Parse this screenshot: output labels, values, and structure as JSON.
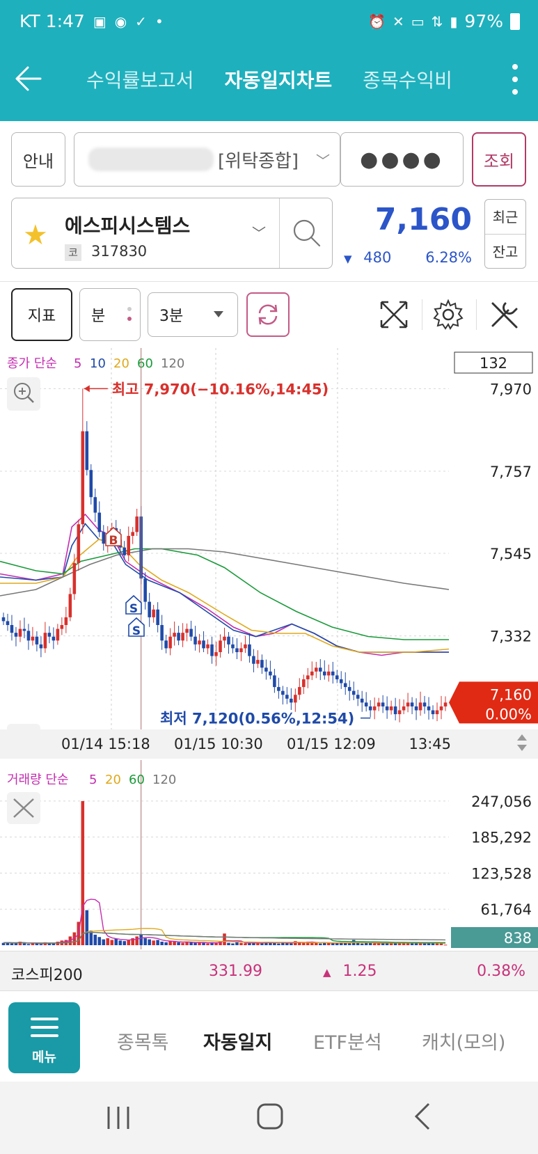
{
  "status_bar": {
    "carrier_time": "KT 1:47",
    "icons_left": [
      "gallery-icon",
      "talk-icon",
      "inv-icon",
      "dot-icon"
    ],
    "battery": "97%",
    "icons_right": [
      "alarm-icon",
      "mute-icon",
      "hd-icon",
      "5g-icon",
      "signal-icon",
      "battery-icon"
    ]
  },
  "header": {
    "tabs": [
      {
        "label": "수익률보고서",
        "active": false
      },
      {
        "label": "자동일지차트",
        "active": true
      },
      {
        "label": "종목수익비",
        "active": false
      }
    ]
  },
  "account_row": {
    "guide_label": "안내",
    "account_text": "[위탁종합]",
    "password_mask": "●●●●",
    "lookup_label": "조회"
  },
  "stock": {
    "name": "에스피시스템스",
    "market_badge": "코",
    "code": "317830",
    "price": "7,160",
    "change": "480",
    "change_pct": "6.28%",
    "recent_label": "최근",
    "balance_label": "잔고",
    "colors": {
      "down": "#2b55c8",
      "up": "#d8302c"
    }
  },
  "toolbar": {
    "indicator_label": "지표",
    "minute_label": "분",
    "interval_value": "3분"
  },
  "chart_data": [
    {
      "type": "candlestick",
      "legend": {
        "prefix": "종가 단순",
        "periods": [
          {
            "label": "5",
            "color": "#c42cb0"
          },
          {
            "label": "10",
            "color": "#1f4aa8"
          },
          {
            "label": "20",
            "color": "#e0a81a"
          },
          {
            "label": "60",
            "color": "#1a9a3a"
          },
          {
            "label": "120",
            "color": "#777777"
          }
        ]
      },
      "counter_label": "132",
      "y_ticks": [
        "7,970",
        "7,757",
        "7,545",
        "7,332"
      ],
      "ylim": [
        7105,
        7985
      ],
      "x_labels": [
        "01/14 15:18",
        "01/15 10:30",
        "01/15 12:09",
        "13:45"
      ],
      "high_annotation": "최고 7,970(−10.16%,14:45)",
      "low_annotation": "최저 7,120(0.56%,12:54)",
      "last_price_tag": {
        "price": "7,160",
        "pct": "0.00%"
      },
      "markers": [
        "B",
        "S",
        "S"
      ],
      "close": [
        7370,
        7360,
        7340,
        7330,
        7350,
        7345,
        7320,
        7330,
        7310,
        7300,
        7340,
        7330,
        7320,
        7350,
        7360,
        7380,
        7440,
        7520,
        7620,
        7860,
        7760,
        7690,
        7650,
        7600,
        7570,
        7590,
        7610,
        7580,
        7560,
        7540,
        7590,
        7600,
        7640,
        7480,
        7420,
        7380,
        7400,
        7360,
        7320,
        7300,
        7330,
        7340,
        7320,
        7340,
        7350,
        7330,
        7310,
        7320,
        7300,
        7310,
        7280,
        7290,
        7320,
        7330,
        7310,
        7300,
        7290,
        7300,
        7310,
        7280,
        7260,
        7270,
        7250,
        7240,
        7230,
        7200,
        7190,
        7180,
        7170,
        7160,
        7180,
        7200,
        7220,
        7230,
        7240,
        7250,
        7240,
        7230,
        7240,
        7230,
        7220,
        7210,
        7200,
        7190,
        7180,
        7170,
        7160,
        7150,
        7140,
        7150,
        7160,
        7150,
        7140,
        7150,
        7130,
        7140,
        7150,
        7160,
        7150,
        7140,
        7160,
        7150,
        7140,
        7130,
        7140,
        7150,
        7160
      ],
      "ma_percent_paths": {
        "ma5": [
          [
            0,
            61
          ],
          [
            8,
            63
          ],
          [
            14,
            61
          ],
          [
            16,
            46
          ],
          [
            19,
            42
          ],
          [
            22,
            47
          ],
          [
            25,
            49
          ],
          [
            28,
            57
          ],
          [
            33,
            62
          ],
          [
            40,
            67
          ],
          [
            46,
            72
          ],
          [
            52,
            78
          ],
          [
            57,
            81
          ],
          [
            61,
            80
          ],
          [
            65,
            77
          ],
          [
            70,
            80
          ],
          [
            75,
            84
          ],
          [
            80,
            86
          ],
          [
            85,
            87
          ],
          [
            90,
            86
          ],
          [
            96,
            86
          ],
          [
            100,
            86
          ]
        ],
        "ma10": [
          [
            0,
            62
          ],
          [
            8,
            63
          ],
          [
            14,
            62
          ],
          [
            16,
            52
          ],
          [
            19,
            45
          ],
          [
            22,
            50
          ],
          [
            25,
            51
          ],
          [
            28,
            58
          ],
          [
            33,
            63
          ],
          [
            40,
            67
          ],
          [
            46,
            73
          ],
          [
            52,
            79
          ],
          [
            57,
            81
          ],
          [
            61,
            79
          ],
          [
            65,
            77
          ],
          [
            70,
            80
          ],
          [
            75,
            84
          ],
          [
            80,
            86
          ],
          [
            85,
            86
          ],
          [
            90,
            86
          ],
          [
            96,
            86
          ],
          [
            100,
            86
          ]
        ],
        "ma20": [
          [
            0,
            64
          ],
          [
            8,
            64
          ],
          [
            14,
            62
          ],
          [
            17,
            56
          ],
          [
            22,
            50
          ],
          [
            27,
            52
          ],
          [
            31,
            58
          ],
          [
            36,
            63
          ],
          [
            42,
            67
          ],
          [
            50,
            74
          ],
          [
            56,
            79
          ],
          [
            62,
            80
          ],
          [
            68,
            80
          ],
          [
            74,
            84
          ],
          [
            80,
            86
          ],
          [
            86,
            86
          ],
          [
            92,
            86
          ],
          [
            100,
            85
          ]
        ],
        "ma60": [
          [
            0,
            57
          ],
          [
            8,
            60
          ],
          [
            14,
            61
          ],
          [
            18,
            57
          ],
          [
            24,
            55
          ],
          [
            30,
            53
          ],
          [
            36,
            53
          ],
          [
            44,
            55
          ],
          [
            50,
            59
          ],
          [
            58,
            67
          ],
          [
            66,
            73
          ],
          [
            74,
            78
          ],
          [
            82,
            81
          ],
          [
            90,
            82
          ],
          [
            100,
            82
          ]
        ],
        "ma120": [
          [
            0,
            68
          ],
          [
            8,
            66
          ],
          [
            14,
            62
          ],
          [
            20,
            58
          ],
          [
            26,
            55
          ],
          [
            34,
            53
          ],
          [
            42,
            53
          ],
          [
            50,
            54
          ],
          [
            58,
            56
          ],
          [
            66,
            58
          ],
          [
            74,
            60
          ],
          [
            82,
            62
          ],
          [
            90,
            64
          ],
          [
            100,
            66
          ]
        ]
      }
    },
    {
      "type": "bar",
      "legend": {
        "prefix": "거래량 단순",
        "periods": [
          {
            "label": "5",
            "color": "#c42cb0"
          },
          {
            "label": "20",
            "color": "#e0a81a"
          },
          {
            "label": "60",
            "color": "#1a9a3a"
          },
          {
            "label": "120",
            "color": "#777777"
          }
        ]
      },
      "y_ticks": [
        "247,056",
        "185,292",
        "123,528",
        "61,764"
      ],
      "ylim": [
        0,
        260000
      ],
      "current_tag": "838",
      "values": [
        4000,
        5000,
        3000,
        4000,
        6000,
        3000,
        2000,
        4000,
        3000,
        2000,
        5000,
        4000,
        3000,
        6000,
        8000,
        9000,
        15000,
        22000,
        40000,
        247000,
        60000,
        25000,
        18000,
        14000,
        10000,
        12000,
        9000,
        11000,
        8000,
        7000,
        9000,
        12000,
        15000,
        18000,
        12000,
        10000,
        8000,
        9000,
        6000,
        5000,
        7000,
        6000,
        5000,
        4000,
        6000,
        5000,
        4000,
        5000,
        4000,
        3000,
        5000,
        4000,
        6000,
        20000,
        4000,
        3000,
        5000,
        4000,
        3000,
        5000,
        4000,
        3000,
        4000,
        6000,
        5000,
        4000,
        3000,
        5000,
        4000,
        3000,
        7000,
        5000,
        4000,
        6000,
        5000,
        4000,
        3000,
        5000,
        4000,
        3000,
        4000,
        5000,
        4000,
        3000,
        9000,
        4000,
        3000,
        5000,
        4000,
        3000,
        4000,
        3000,
        5000,
        4000,
        3000,
        4000,
        5000,
        4000,
        3000,
        4000,
        3000,
        4000,
        5000,
        3000,
        4000,
        3000,
        838
      ]
    }
  ],
  "kospi": {
    "name": "코스피200",
    "value": "331.99",
    "change": "1.25",
    "pct": "0.38%"
  },
  "bottom_nav": {
    "menu_label": "메뉴",
    "items": [
      {
        "label": "종목톡",
        "active": false
      },
      {
        "label": "자동일지",
        "active": true
      },
      {
        "label": "ETF분석",
        "active": false
      },
      {
        "label": "캐치(모의)",
        "active": false
      }
    ]
  }
}
